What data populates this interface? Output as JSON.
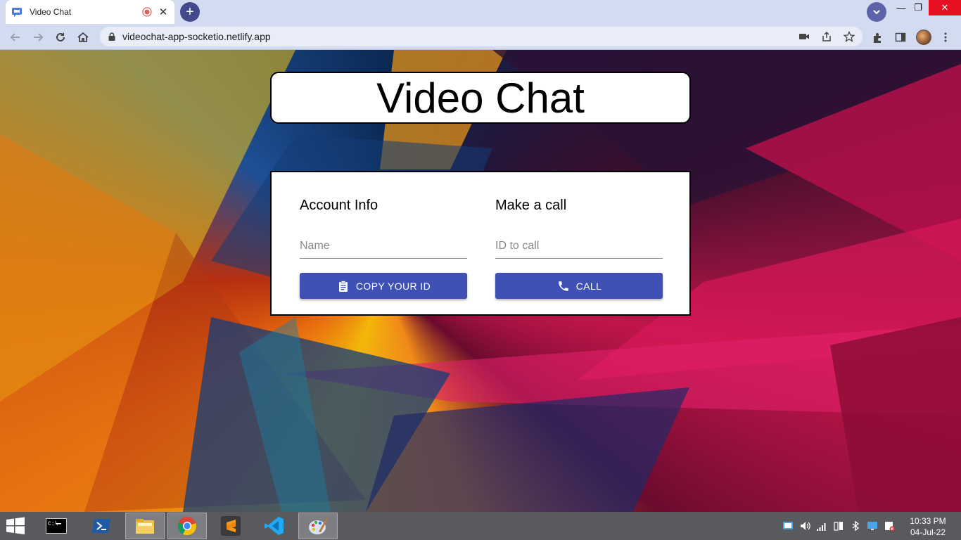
{
  "browser": {
    "tab_title": "Video Chat",
    "url": "videochat-app-socketio.netlify.app",
    "new_tab_symbol": "+",
    "close_symbol": "✕",
    "minimize_symbol": "—",
    "restore_symbol": "❐",
    "window_close_symbol": "✕"
  },
  "page": {
    "title": "Video Chat",
    "account": {
      "heading": "Account Info",
      "name_placeholder": "Name",
      "copy_button": "COPY YOUR ID"
    },
    "call": {
      "heading": "Make a call",
      "id_placeholder": "ID to call",
      "call_button": "CALL"
    }
  },
  "taskbar": {
    "time": "10:33 PM",
    "date": "04-Jul-22",
    "apps": [
      "cmd-icon",
      "powershell-icon",
      "file-explorer-icon",
      "chrome-icon",
      "sublime-icon",
      "vscode-icon",
      "paint-icon"
    ]
  },
  "colors": {
    "accent": "#3f51b5",
    "chrome_frame": "#d3dbf0",
    "taskbar": "#585a5e"
  }
}
